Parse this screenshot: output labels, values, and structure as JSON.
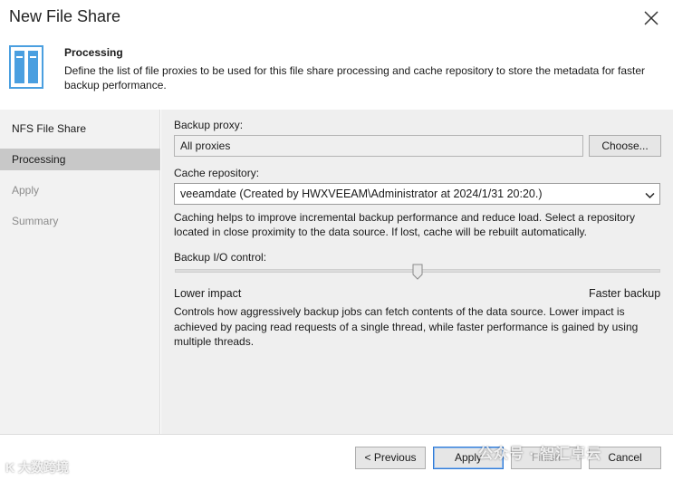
{
  "window": {
    "title": "New File Share"
  },
  "header": {
    "title": "Processing",
    "description": "Define the list of file proxies to be used for this file share processing and cache repository to store the metadata for faster backup performance."
  },
  "sidebar": {
    "items": [
      {
        "label": "NFS File Share",
        "state": "normal"
      },
      {
        "label": "Processing",
        "state": "active"
      },
      {
        "label": "Apply",
        "state": "disabled"
      },
      {
        "label": "Summary",
        "state": "disabled"
      }
    ]
  },
  "form": {
    "backup_proxy_label": "Backup proxy:",
    "backup_proxy_value": "All proxies",
    "choose_label": "Choose...",
    "cache_repository_label": "Cache repository:",
    "cache_repository_value": "veeamdate (Created by HWXVEEAM\\Administrator at 2024/1/31 20:20.)",
    "cache_note": "Caching helps to improve incremental backup performance and reduce load. Select a repository located in close proximity to the data source. If lost, cache will be rebuilt automatically.",
    "io_control_label": "Backup I/O control:",
    "io_slider_fraction": 0.5,
    "lower_impact": "Lower impact",
    "faster_backup": "Faster backup",
    "io_note": "Controls how aggressively backup jobs can fetch contents of the data source. Lower impact is achieved by pacing read requests of a single thread, while faster performance is gained by using multiple threads."
  },
  "footer": {
    "previous_label": "< Previous",
    "apply_label": "Apply",
    "finish_label": "Finish",
    "cancel_label": "Cancel"
  },
  "watermarks": {
    "left": "K 大数跨境",
    "right": "公众号 · 智汇卓云"
  },
  "colors": {
    "sidebar_bg": "#f2f2f2",
    "sidebar_active": "#c8c8c8",
    "content_bg": "#efefef",
    "accent_border": "#2f7ad6",
    "icon_blue": "#4a9fe0"
  }
}
